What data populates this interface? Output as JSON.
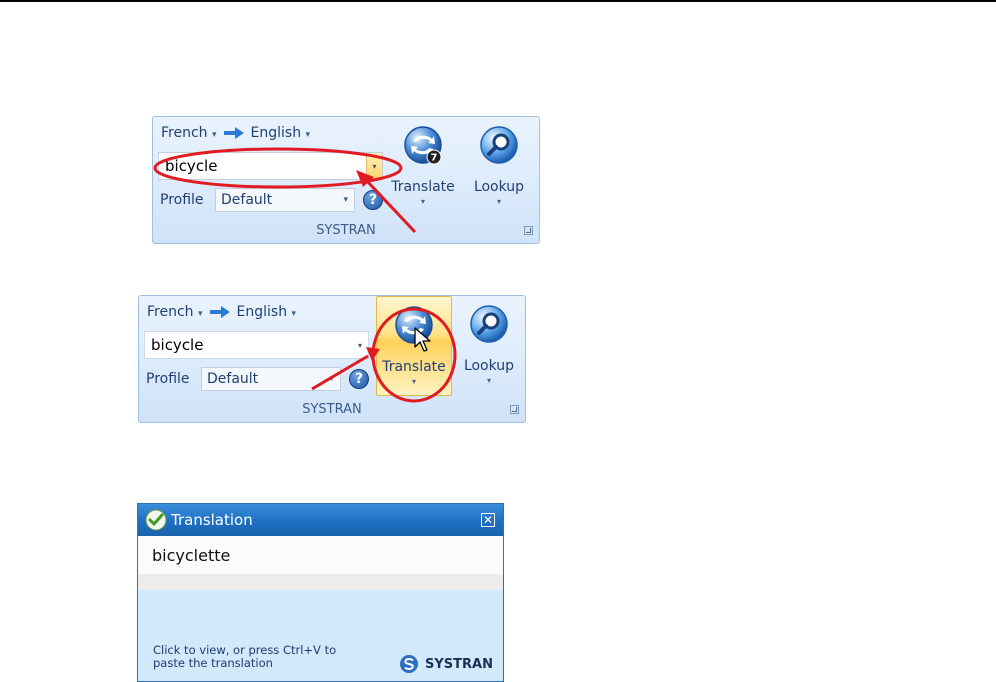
{
  "ribbon1": {
    "source_lang": "French",
    "target_lang": "English",
    "term": "bicycle",
    "profile_label": "Profile",
    "profile_value": "Default",
    "translate_label": "Translate",
    "lookup_label": "Lookup",
    "group_label": "SYSTRAN",
    "translate_badge": "7"
  },
  "ribbon2": {
    "source_lang": "French",
    "target_lang": "English",
    "term": "bicycle",
    "profile_label": "Profile",
    "profile_value": "Default",
    "translate_label": "Translate",
    "lookup_label": "Lookup",
    "group_label": "SYSTRAN"
  },
  "popup": {
    "title": "Translation",
    "result": "bicyclette",
    "hint_line1": "Click to view, or press Ctrl+V to",
    "hint_line2": "paste the translation",
    "brand": "SYSTRAN"
  },
  "icons": {
    "dropdown": "▾",
    "help": "?",
    "close": "✕"
  },
  "colors": {
    "annotation_red": "#e11b22",
    "ribbon_bg": "#dcebfb",
    "title_blue": "#1d6fc1",
    "hover_gold": "#ffd15a"
  }
}
